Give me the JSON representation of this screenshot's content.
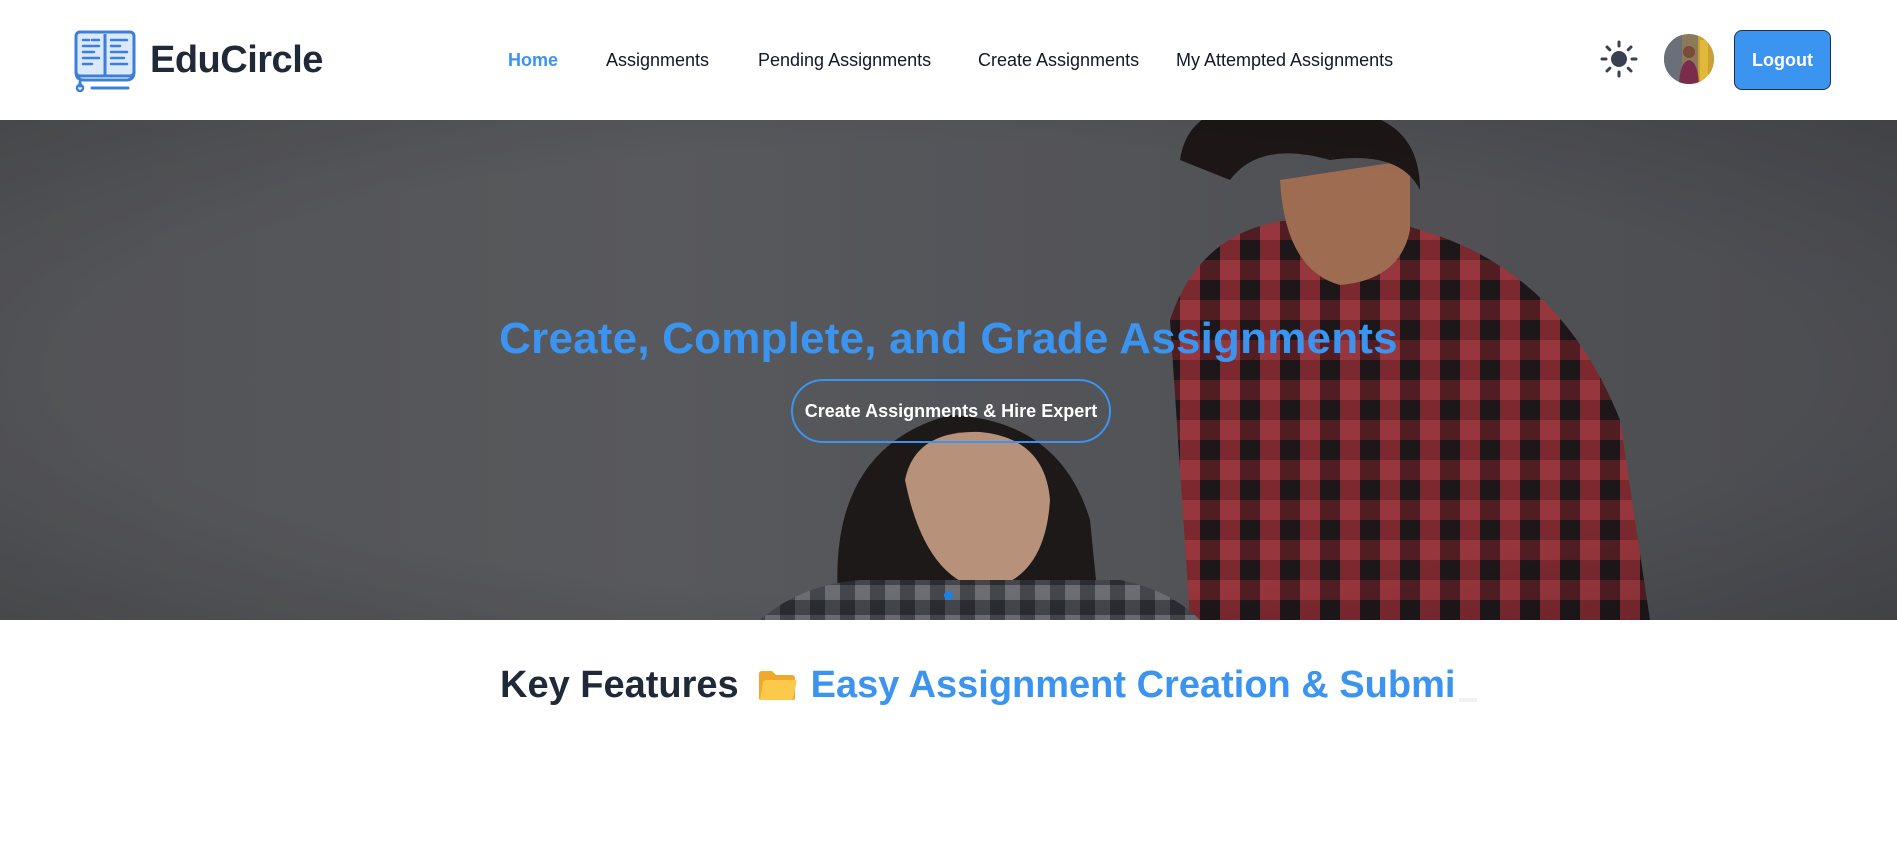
{
  "brand": {
    "name": "EduCircle",
    "logo_icon": "book-logo-icon"
  },
  "nav": {
    "links": [
      {
        "label": "Home",
        "active": true
      },
      {
        "label": "Assignments",
        "active": false
      },
      {
        "label": "Pending Assignments",
        "active": false
      },
      {
        "label": "Create Assignments",
        "active": false
      },
      {
        "label": "My Attempted Assignments",
        "active": false
      }
    ],
    "theme_icon": "sun-icon",
    "logout_label": "Logout"
  },
  "hero": {
    "title": "Create, Complete, and Grade Assignments",
    "cta_label": "Create Assignments & Hire Expert",
    "slides_count": 1,
    "active_slide": 1
  },
  "features": {
    "heading": "Key Features",
    "icon": "folder-icon",
    "typed_text": "Easy Assignment Creation & Submi"
  },
  "colors": {
    "accent": "#3b94ef",
    "text_dark": "#1f2937",
    "hero_bg": "#5f6063",
    "logout_border": "#1f2f4d"
  }
}
